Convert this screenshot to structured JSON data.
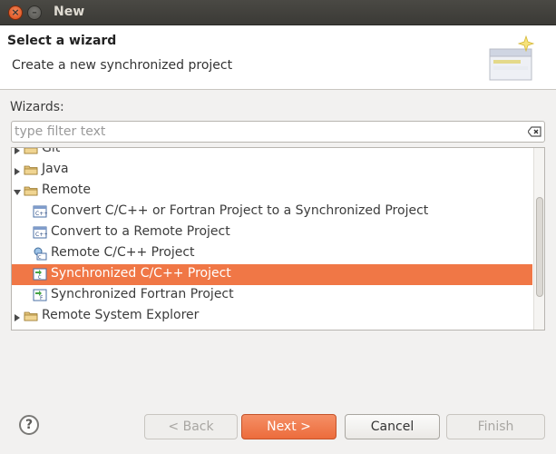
{
  "window": {
    "title": "New"
  },
  "header": {
    "title": "Select a wizard",
    "description": "Create a new synchronized project",
    "art_icon": "wizard-banner-icon"
  },
  "wizards_label": "Wizards:",
  "filter": {
    "value": "",
    "placeholder": "type filter text",
    "clear_icon": "clear-filter-icon"
  },
  "tree": {
    "items": [
      {
        "label": "Git",
        "type": "folder",
        "expanded": false,
        "level": 0
      },
      {
        "label": "Java",
        "type": "folder",
        "expanded": false,
        "level": 0
      },
      {
        "label": "Remote",
        "type": "folder",
        "expanded": true,
        "level": 0
      },
      {
        "label": "Convert C/C++ or Fortran Project to a Synchronized Project",
        "type": "wizard",
        "icon": "cpp-convert-icon",
        "level": 1
      },
      {
        "label": "Convert to a Remote Project",
        "type": "wizard",
        "icon": "cpp-convert-icon",
        "level": 1
      },
      {
        "label": "Remote C/C++ Project",
        "type": "wizard",
        "icon": "remote-cpp-icon",
        "level": 1
      },
      {
        "label": "Synchronized C/C++ Project",
        "type": "wizard",
        "icon": "sync-cpp-icon",
        "level": 1,
        "selected": true
      },
      {
        "label": "Synchronized Fortran Project",
        "type": "wizard",
        "icon": "sync-fortran-icon",
        "level": 1
      },
      {
        "label": "Remote System Explorer",
        "type": "folder",
        "expanded": false,
        "level": 0
      }
    ]
  },
  "buttons": {
    "back": "< Back",
    "next": "Next >",
    "cancel": "Cancel",
    "finish": "Finish",
    "help": "?"
  },
  "colors": {
    "selection": "#f07746",
    "titlebar": "#3c3b37",
    "next_button": "#ef7a4b"
  }
}
